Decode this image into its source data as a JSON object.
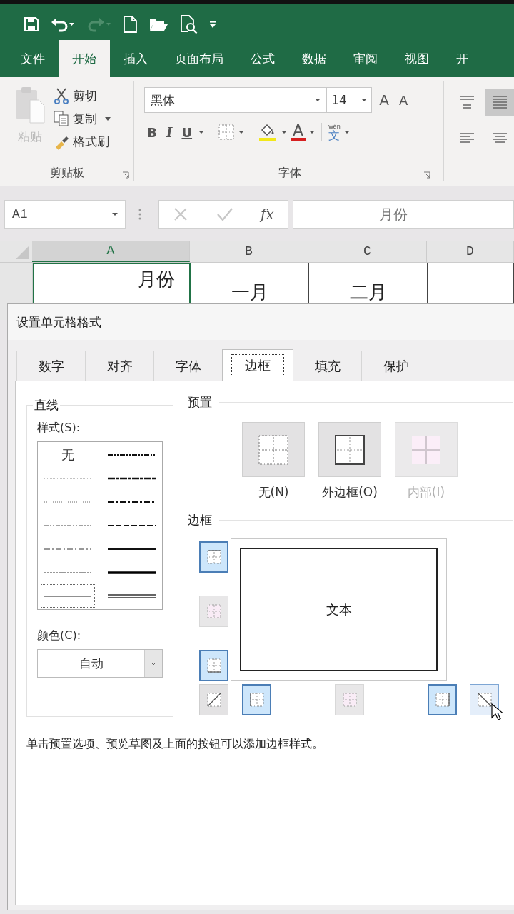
{
  "quick_access": [
    {
      "kind": "save",
      "disabled": false
    },
    {
      "kind": "undo",
      "disabled": false
    },
    {
      "kind": "redo",
      "disabled": true
    },
    {
      "kind": "new",
      "disabled": false
    },
    {
      "kind": "open",
      "disabled": false
    },
    {
      "kind": "preview",
      "disabled": false
    },
    {
      "kind": "customize",
      "disabled": false
    }
  ],
  "ribbon_tabs": [
    {
      "label": "文件",
      "selected": false
    },
    {
      "label": "开始",
      "selected": true
    },
    {
      "label": "插入",
      "selected": false
    },
    {
      "label": "页面布局",
      "selected": false
    },
    {
      "label": "公式",
      "selected": false
    },
    {
      "label": "数据",
      "selected": false
    },
    {
      "label": "审阅",
      "selected": false
    },
    {
      "label": "视图",
      "selected": false
    },
    {
      "label": "开",
      "selected": false
    }
  ],
  "clipboard": {
    "paste": {
      "label": "粘贴",
      "disabled": true
    },
    "cut": "剪切",
    "copy": "复制",
    "format_painter": "格式刷",
    "group_label": "剪贴板"
  },
  "font": {
    "name": "黑体",
    "size": "14",
    "grow": "A",
    "shrink": "A",
    "bold": "B",
    "italic": "I",
    "underline": "U",
    "font_color_letter": "A",
    "phonetic_top": "wén",
    "phonetic_char": "文",
    "group_label": "字体"
  },
  "align_buttons": [
    {
      "kind": "top",
      "selected": false
    },
    {
      "kind": "middle",
      "selected": true
    },
    {
      "kind": "left",
      "selected": false
    },
    {
      "kind": "center",
      "selected": false
    }
  ],
  "formula_bar": {
    "name_box": "A1",
    "fx": "fx",
    "formula": "月份"
  },
  "columns": [
    {
      "label": "A",
      "selected": true
    },
    {
      "label": "B",
      "selected": false
    },
    {
      "label": "C",
      "selected": false
    },
    {
      "label": "D",
      "selected": false
    }
  ],
  "cells": [
    {
      "top": "月份"
    },
    {
      "top": "一月"
    },
    {
      "top": "二月"
    }
  ],
  "dialog": {
    "title": "设置单元格格式",
    "tabs": [
      {
        "label": "数字",
        "selected": false
      },
      {
        "label": "对齐",
        "selected": false
      },
      {
        "label": "字体",
        "selected": false
      },
      {
        "label": "边框",
        "selected": true
      },
      {
        "label": "填充",
        "selected": false
      },
      {
        "label": "保护",
        "selected": false
      }
    ],
    "line": {
      "title": "直线",
      "style_label": "样式(S):",
      "color_label": "颜色(C):",
      "color_value": "自动",
      "styles_left": [
        {
          "kind": "none",
          "label": "无",
          "selected": false
        },
        {
          "kind": "hair",
          "selected": false
        },
        {
          "kind": "dotted",
          "selected": false
        },
        {
          "kind": "dashdotdot",
          "selected": false
        },
        {
          "kind": "dashdot",
          "selected": false
        },
        {
          "kind": "dashed",
          "selected": false
        },
        {
          "kind": "thin",
          "selected": true
        }
      ],
      "styles_right": [
        {
          "kind": "medium_dashdotdot",
          "selected": false
        },
        {
          "kind": "slant_dashdot",
          "selected": false
        },
        {
          "kind": "medium_dashdot",
          "selected": false
        },
        {
          "kind": "medium_dashed",
          "selected": false
        },
        {
          "kind": "medium",
          "selected": false
        },
        {
          "kind": "thick",
          "selected": false
        },
        {
          "kind": "double",
          "selected": false
        }
      ]
    },
    "presets": {
      "title": "预置",
      "items": [
        {
          "kind": "none",
          "label": "无(N)",
          "disabled": false
        },
        {
          "kind": "outline",
          "label": "外边框(O)",
          "disabled": false
        },
        {
          "kind": "inside",
          "label": "内部(I)",
          "disabled": true
        }
      ]
    },
    "border": {
      "title": "边框",
      "preview_text": "文本",
      "left_buttons": [
        {
          "kind": "top",
          "on": true,
          "disabled": false
        },
        {
          "kind": "middle",
          "on": false,
          "disabled": true
        },
        {
          "kind": "bottom",
          "on": true,
          "disabled": false
        }
      ],
      "bottom_buttons": [
        {
          "kind": "diagonal_up",
          "on": false,
          "disabled": false
        },
        {
          "kind": "left",
          "on": true,
          "disabled": false
        },
        {
          "kind": "center",
          "on": false,
          "disabled": true
        },
        {
          "kind": "right",
          "on": true,
          "disabled": false
        },
        {
          "kind": "diagonal_down",
          "on": false,
          "disabled": false,
          "hovered": true
        }
      ]
    },
    "hint": "单击预置选项、预览草图及上面的按钮可以添加边框样式。"
  }
}
